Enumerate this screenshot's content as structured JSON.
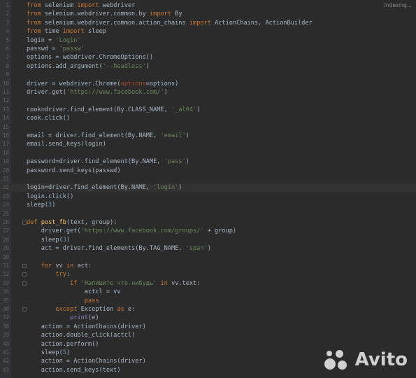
{
  "status": {
    "indexing": "Indexing..."
  },
  "watermark": {
    "brand": "Avito"
  },
  "colors": {
    "keyword": "#cc7832",
    "string": "#6a8759",
    "number": "#6897bb",
    "function": "#ffc66d",
    "param": "#aa4926"
  },
  "editor": {
    "current_line": 22,
    "lines": [
      {
        "n": "1",
        "code": "from selenium import webdriver"
      },
      {
        "n": "2",
        "code": "from selenium.webdriver.common.by import By"
      },
      {
        "n": "3",
        "code": "from selenium.webdriver.common.action_chains import ActionChains, ActionBuilder"
      },
      {
        "n": "4",
        "code": "from time import sleep"
      },
      {
        "n": "5",
        "code": "login = 'Login'"
      },
      {
        "n": "6",
        "code": "passwd = 'passw'"
      },
      {
        "n": "7",
        "code": "options = webdriver.ChromeOptions()"
      },
      {
        "n": "8",
        "code": "options.add_argument('--headless')"
      },
      {
        "n": "9",
        "code": ""
      },
      {
        "n": "10",
        "code": "driver = webdriver.Chrome(options=options)"
      },
      {
        "n": "11",
        "code": "driver.get('https://www.facebook.com/')"
      },
      {
        "n": "12",
        "code": ""
      },
      {
        "n": "13",
        "code": "cook=driver.find_element(By.CLASS_NAME, '_al04')"
      },
      {
        "n": "14",
        "code": "cook.click()"
      },
      {
        "n": "15",
        "code": ""
      },
      {
        "n": "16",
        "code": "email = driver.find_element(By.NAME, 'email')"
      },
      {
        "n": "17",
        "code": "email.send_keys(login)"
      },
      {
        "n": "18",
        "code": ""
      },
      {
        "n": "19",
        "code": "password=driver.find_element(By.NAME, 'pass')"
      },
      {
        "n": "20",
        "code": "password.send_keys(passwd)"
      },
      {
        "n": "21",
        "code": ""
      },
      {
        "n": "22",
        "code": "login=driver.find_element(By.NAME, 'login')"
      },
      {
        "n": "23",
        "code": "login.click()"
      },
      {
        "n": "24",
        "code": "sleep(3)"
      },
      {
        "n": "25",
        "code": ""
      },
      {
        "n": "26",
        "code": "def post_fb(text, group):"
      },
      {
        "n": "27",
        "code": "    driver.get('https://www.facebook.com/groups/' + group)"
      },
      {
        "n": "28",
        "code": "    sleep(3)"
      },
      {
        "n": "29",
        "code": "    act = driver.find_elements(By.TAG_NAME, 'span')"
      },
      {
        "n": "30",
        "code": ""
      },
      {
        "n": "31",
        "code": "    for vv in act:"
      },
      {
        "n": "32",
        "code": "        try:"
      },
      {
        "n": "33",
        "code": "            if 'Напишите что-нибудь' in vv.text:"
      },
      {
        "n": "34",
        "code": "                actcl = vv"
      },
      {
        "n": "35",
        "code": "                pass"
      },
      {
        "n": "36",
        "code": "        except Exception as e:"
      },
      {
        "n": "37",
        "code": "            print(e)"
      },
      {
        "n": "38",
        "code": "    action = ActionChains(driver)"
      },
      {
        "n": "39",
        "code": "    action.double_click(actcl)"
      },
      {
        "n": "40",
        "code": "    action.perform()"
      },
      {
        "n": "41",
        "code": "    sleep(5)"
      },
      {
        "n": "42",
        "code": "    action = ActionChains(driver)"
      },
      {
        "n": "43",
        "code": "    action.send_keys(text)"
      }
    ]
  }
}
